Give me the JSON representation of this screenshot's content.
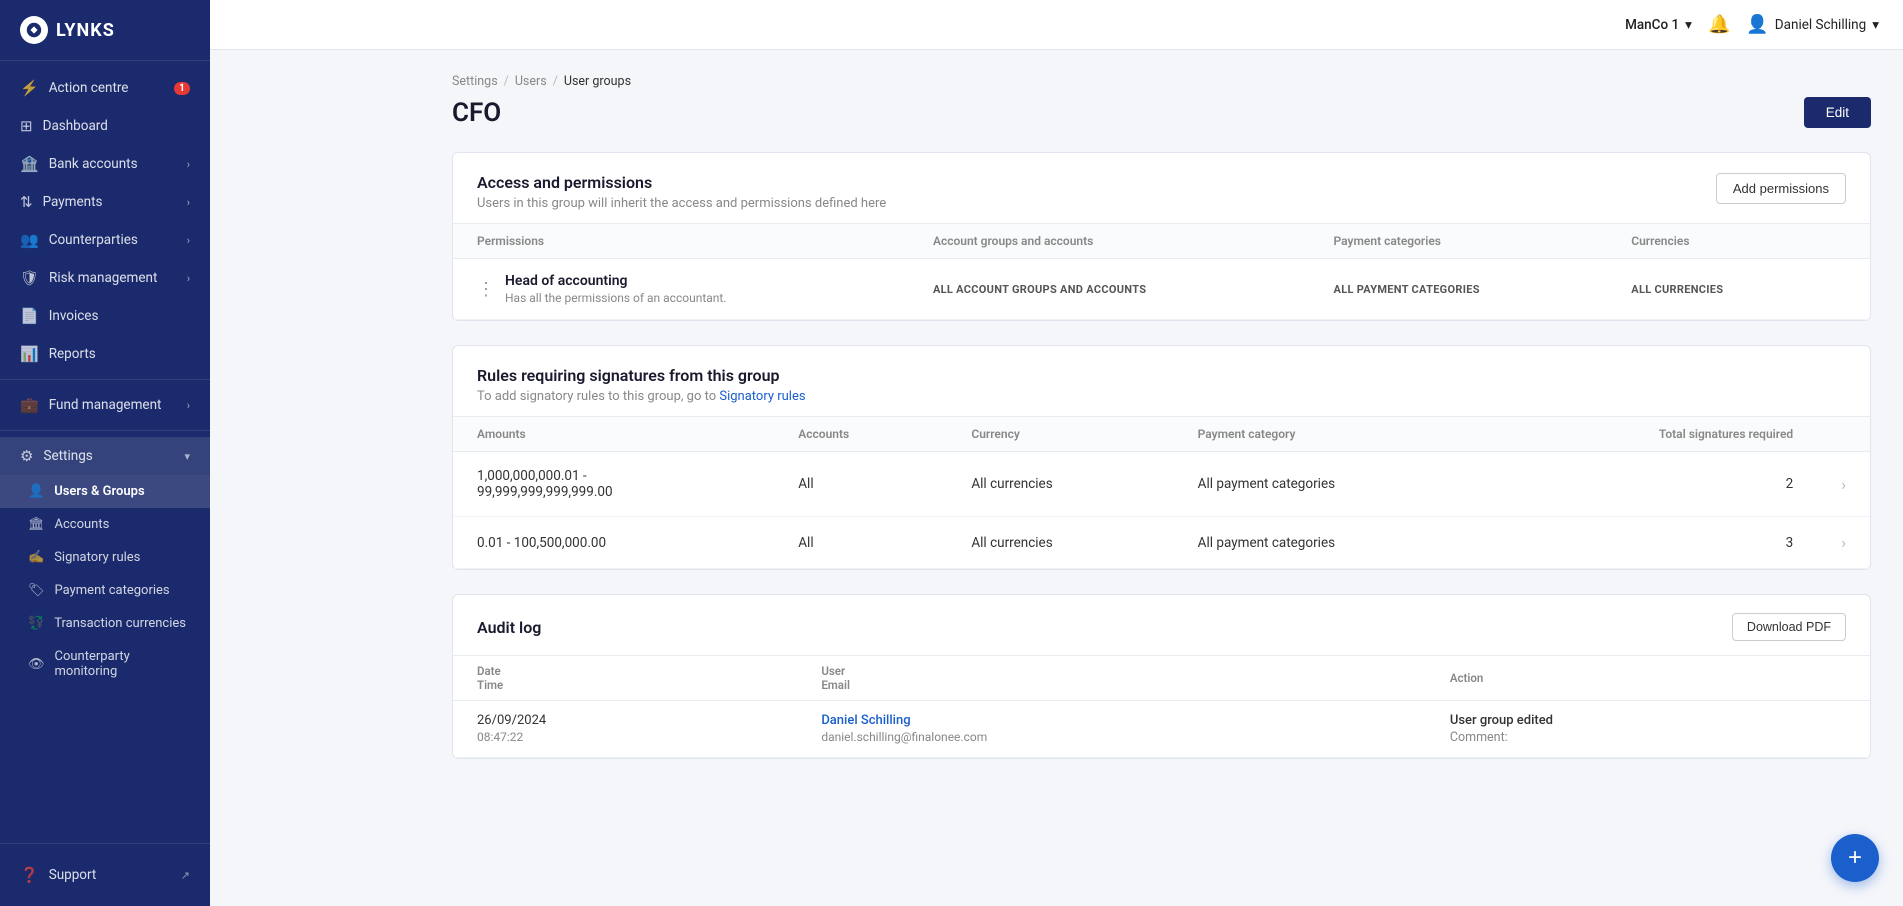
{
  "app": {
    "name": "LYNKS"
  },
  "topbar": {
    "manco": "ManCo 1",
    "user": "Daniel Schilling",
    "chevron": "▾"
  },
  "sidebar": {
    "nav_items": [
      {
        "id": "action-centre",
        "label": "Action centre",
        "icon": "⚡",
        "badge": "1"
      },
      {
        "id": "dashboard",
        "label": "Dashboard",
        "icon": "⊞"
      },
      {
        "id": "bank-accounts",
        "label": "Bank accounts",
        "icon": "🏦",
        "chevron": "›"
      },
      {
        "id": "payments",
        "label": "Payments",
        "icon": "↕",
        "chevron": "›"
      },
      {
        "id": "counterparties",
        "label": "Counterparties",
        "icon": "👥",
        "chevron": "›"
      },
      {
        "id": "risk-management",
        "label": "Risk management",
        "icon": "🛡",
        "chevron": "›"
      },
      {
        "id": "invoices",
        "label": "Invoices",
        "icon": "📄"
      },
      {
        "id": "reports",
        "label": "Reports",
        "icon": "📊"
      }
    ],
    "divider_after": [
      "reports"
    ],
    "fund_management": {
      "label": "Fund management",
      "icon": "💼",
      "chevron": "›"
    },
    "settings": {
      "label": "Settings",
      "icon": "⚙",
      "chevron": "▾",
      "sub_items": [
        {
          "id": "users-groups",
          "label": "Users & Groups",
          "icon": "👤",
          "active": true
        },
        {
          "id": "accounts",
          "label": "Accounts",
          "icon": "🏛"
        },
        {
          "id": "signatory-rules",
          "label": "Signatory rules",
          "icon": "✍"
        },
        {
          "id": "payment-categories",
          "label": "Payment categories",
          "icon": "🏷"
        },
        {
          "id": "transaction-currencies",
          "label": "Transaction currencies",
          "icon": "💱"
        },
        {
          "id": "counterparty-monitoring",
          "label": "Counterparty monitoring",
          "icon": "👁"
        }
      ]
    },
    "support": {
      "label": "Support",
      "icon": "❓"
    }
  },
  "breadcrumb": {
    "items": [
      "Settings",
      "Users",
      "User groups"
    ]
  },
  "page": {
    "title": "CFO",
    "edit_button": "Edit"
  },
  "access_permissions": {
    "title": "Access and permissions",
    "subtitle": "Users in this group will inherit the access and permissions defined here",
    "add_button": "Add permissions",
    "columns": [
      "Permissions",
      "Account groups and accounts",
      "Payment categories",
      "Currencies"
    ],
    "rows": [
      {
        "name": "Head of accounting",
        "description": "Has all the permissions of an accountant.",
        "account_groups": "ALL ACCOUNT GROUPS AND ACCOUNTS",
        "payment_categories": "ALL PAYMENT CATEGORIES",
        "currencies": "ALL CURRENCIES"
      }
    ]
  },
  "signatory_rules": {
    "title": "Rules requiring signatures from this group",
    "subtitle": "To add signatory rules to this group, go to ",
    "link_text": "Signatory rules",
    "columns": [
      "Amounts",
      "Accounts",
      "Currency",
      "Payment category",
      "Total signatures required"
    ],
    "rows": [
      {
        "amounts": "1,000,000,000.01 -\n99,999,999,999,999.00",
        "accounts": "All",
        "currency": "All currencies",
        "payment_category": "All payment categories",
        "total_signatures": "2"
      },
      {
        "amounts": "0.01 - 100,500,000.00",
        "accounts": "All",
        "currency": "All currencies",
        "payment_category": "All payment categories",
        "total_signatures": "3"
      }
    ]
  },
  "audit_log": {
    "title": "Audit log",
    "download_button": "Download PDF",
    "columns": {
      "date_label": "Date",
      "time_label": "Time",
      "user_label": "User",
      "email_label": "Email",
      "action_label": "Action"
    },
    "rows": [
      {
        "date": "26/09/2024",
        "time": "08:47:22",
        "user": "Daniel Schilling",
        "email": "daniel.schilling@finalonee.com",
        "action": "User group edited",
        "comment": "Comment:"
      }
    ]
  },
  "fab": {
    "label": "+"
  }
}
